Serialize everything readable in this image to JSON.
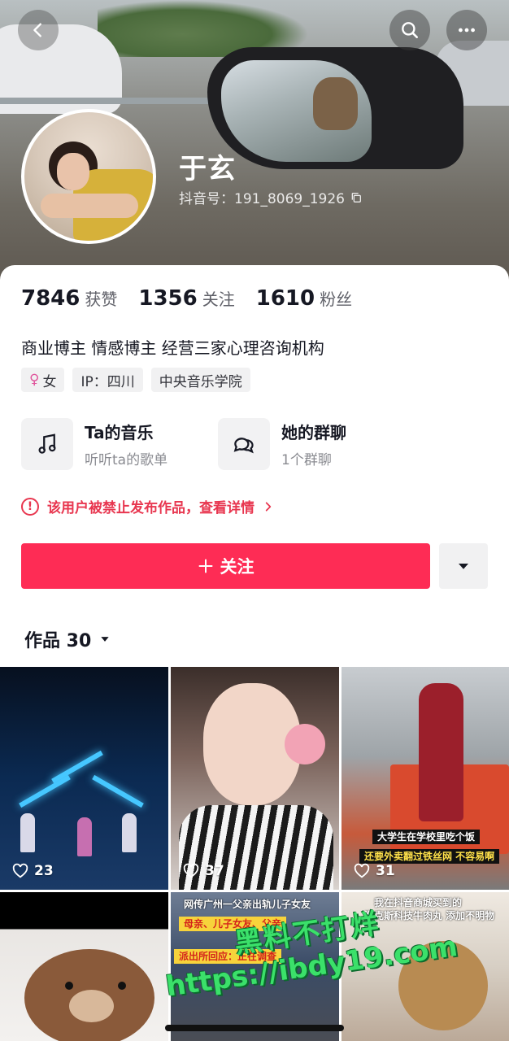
{
  "profile": {
    "name": "于玄",
    "douyin_id_label": "抖音号：191_8069_1926",
    "stats": [
      {
        "value": "7846",
        "label": "获赞"
      },
      {
        "value": "1356",
        "label": "关注"
      },
      {
        "value": "1610",
        "label": "粉丝"
      }
    ],
    "bio": "商业博主 情感博主   经营三家心理咨询机构",
    "tags": {
      "gender": "女",
      "ip": "IP：四川",
      "school": "中央音乐学院"
    },
    "features": {
      "music_title": "Ta的音乐",
      "music_sub": "听听ta的歌单",
      "group_title": "她的群聊",
      "group_sub": "1个群聊"
    },
    "ban_notice": "该用户被禁止发布作品，查看详情",
    "follow_label": "关注",
    "works_label": "作品 30"
  },
  "grid": {
    "tiles": [
      {
        "likes": "23"
      },
      {
        "likes": "37"
      },
      {
        "likes": "31"
      }
    ],
    "captions": {
      "t3_line1": "大学生在学校里吃个饭",
      "t3_line2": "还要外卖翻过铁丝网 不容易啊",
      "t5_line1": "网传广州一父亲出轨儿子女友",
      "t5_line2": "母亲、儿子女友、父亲",
      "t5_line3": "派出所回应：正在调查",
      "t6_line1": "我在抖音商城买到的",
      "t6_line2": "海克斯科技牛肉丸 添加不明物"
    }
  },
  "watermark": {
    "line1": "黑料不打烊",
    "line2": "https://ibdy19.com"
  },
  "colors": {
    "primary_red": "#fe2c55",
    "ban_red": "#e8364f",
    "watermark_green": "#3be06a"
  }
}
